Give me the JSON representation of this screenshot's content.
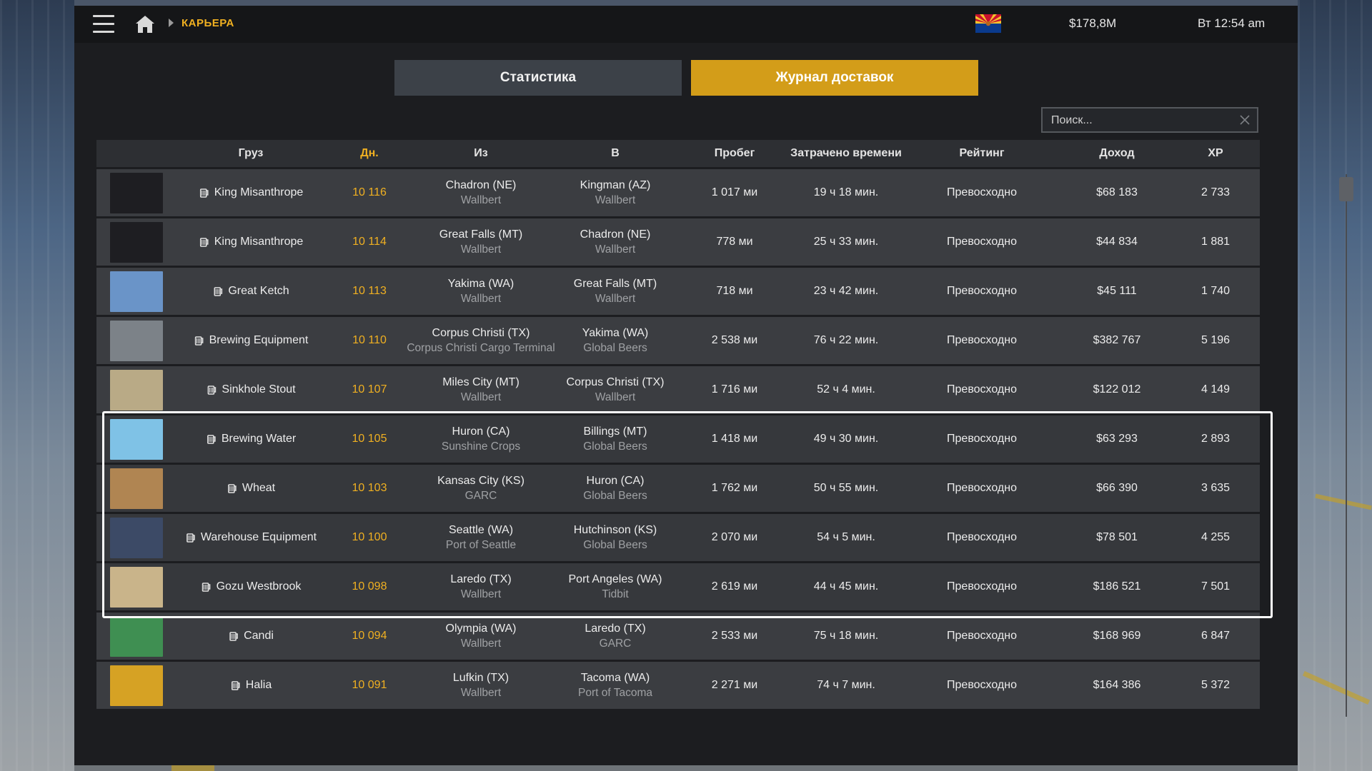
{
  "header": {
    "breadcrumb": "КАРЬЕРА",
    "money": "$178,8M",
    "time": "Вт 12:54 am",
    "menu_icon": "hamburger-icon",
    "home_icon": "home-icon",
    "flag_icon": "arizona-flag-icon"
  },
  "tabs": [
    {
      "label": "Статистика",
      "active": false
    },
    {
      "label": "Журнал доставок",
      "active": true
    }
  ],
  "search": {
    "placeholder": "Поиск...",
    "value": ""
  },
  "colors": {
    "accent": "#f0b021",
    "active_tab": "#d39d19",
    "panel": "#1c1d20",
    "row": "#3b3d41"
  },
  "table": {
    "columns": [
      "Груз",
      "Дн.",
      "Из",
      "В",
      "Пробег",
      "Затрачено времени",
      "Рейтинг",
      "Доход",
      "XP"
    ],
    "sorted_column": "Дн.",
    "rows": [
      {
        "cargo": "King Misanthrope",
        "days": "10 116",
        "from_city": "Chadron (NE)",
        "from_company": "Wallbert",
        "to_city": "Kingman (AZ)",
        "to_company": "Wallbert",
        "distance": "1 017 ми",
        "time": "19 ч 18 мин.",
        "rating": "Превосходно",
        "income": "$68 183",
        "xp": "2 733",
        "thumb_color": "#1e1e22"
      },
      {
        "cargo": "King Misanthrope",
        "days": "10 114",
        "from_city": "Great Falls (MT)",
        "from_company": "Wallbert",
        "to_city": "Chadron (NE)",
        "to_company": "Wallbert",
        "distance": "778 ми",
        "time": "25 ч 33 мин.",
        "rating": "Превосходно",
        "income": "$44 834",
        "xp": "1 881",
        "thumb_color": "#1e1e22"
      },
      {
        "cargo": "Great Ketch",
        "days": "10 113",
        "from_city": "Yakima (WA)",
        "from_company": "Wallbert",
        "to_city": "Great Falls (MT)",
        "to_company": "Wallbert",
        "distance": "718 ми",
        "time": "23 ч 42 мин.",
        "rating": "Превосходно",
        "income": "$45 111",
        "xp": "1 740",
        "thumb_color": "#6a94c8"
      },
      {
        "cargo": "Brewing Equipment",
        "days": "10 110",
        "from_city": "Corpus Christi (TX)",
        "from_company": "Corpus Christi Cargo Terminal",
        "to_city": "Yakima (WA)",
        "to_company": "Global Beers",
        "distance": "2 538 ми",
        "time": "76 ч 22 мин.",
        "rating": "Превосходно",
        "income": "$382 767",
        "xp": "5 196",
        "thumb_color": "#7c8288"
      },
      {
        "cargo": "Sinkhole Stout",
        "days": "10 107",
        "from_city": "Miles City (MT)",
        "from_company": "Wallbert",
        "to_city": "Corpus Christi (TX)",
        "to_company": "Wallbert",
        "distance": "1 716 ми",
        "time": "52 ч 4 мин.",
        "rating": "Превосходно",
        "income": "$122 012",
        "xp": "4 149",
        "thumb_color": "#b9aa86"
      },
      {
        "cargo": "Brewing Water",
        "days": "10 105",
        "from_city": "Huron (CA)",
        "from_company": "Sunshine Crops",
        "to_city": "Billings (MT)",
        "to_company": "Global Beers",
        "distance": "1 418 ми",
        "time": "49 ч 30 мин.",
        "rating": "Превосходно",
        "income": "$63 293",
        "xp": "2 893",
        "thumb_color": "#7fc2e6"
      },
      {
        "cargo": "Wheat",
        "days": "10 103",
        "from_city": "Kansas City (KS)",
        "from_company": "GARC",
        "to_city": "Huron (CA)",
        "to_company": "Global Beers",
        "distance": "1 762 ми",
        "time": "50 ч 55 мин.",
        "rating": "Превосходно",
        "income": "$66 390",
        "xp": "3 635",
        "thumb_color": "#b08552"
      },
      {
        "cargo": "Warehouse Equipment",
        "days": "10 100",
        "from_city": "Seattle (WA)",
        "from_company": "Port of Seattle",
        "to_city": "Hutchinson (KS)",
        "to_company": "Global Beers",
        "distance": "2 070 ми",
        "time": "54 ч 5 мин.",
        "rating": "Превосходно",
        "income": "$78 501",
        "xp": "4 255",
        "thumb_color": "#3c4a66"
      },
      {
        "cargo": "Gozu Westbrook",
        "days": "10 098",
        "from_city": "Laredo (TX)",
        "from_company": "Wallbert",
        "to_city": "Port Angeles (WA)",
        "to_company": "Tidbit",
        "distance": "2 619 ми",
        "time": "44 ч 45 мин.",
        "rating": "Превосходно",
        "income": "$186 521",
        "xp": "7 501",
        "thumb_color": "#c9b48a"
      },
      {
        "cargo": "Candi",
        "days": "10 094",
        "from_city": "Olympia (WA)",
        "from_company": "Wallbert",
        "to_city": "Laredo (TX)",
        "to_company": "GARC",
        "distance": "2 533 ми",
        "time": "75 ч 18 мин.",
        "rating": "Превосходно",
        "income": "$168 969",
        "xp": "6 847",
        "thumb_color": "#3f8f52"
      },
      {
        "cargo": "Halia",
        "days": "10 091",
        "from_city": "Lufkin (TX)",
        "from_company": "Wallbert",
        "to_city": "Tacoma (WA)",
        "to_company": "Port of Tacoma",
        "distance": "2 271 ми",
        "time": "74 ч 7 мин.",
        "rating": "Превосходно",
        "income": "$164 386",
        "xp": "5 372",
        "thumb_color": "#d6a224"
      }
    ]
  }
}
